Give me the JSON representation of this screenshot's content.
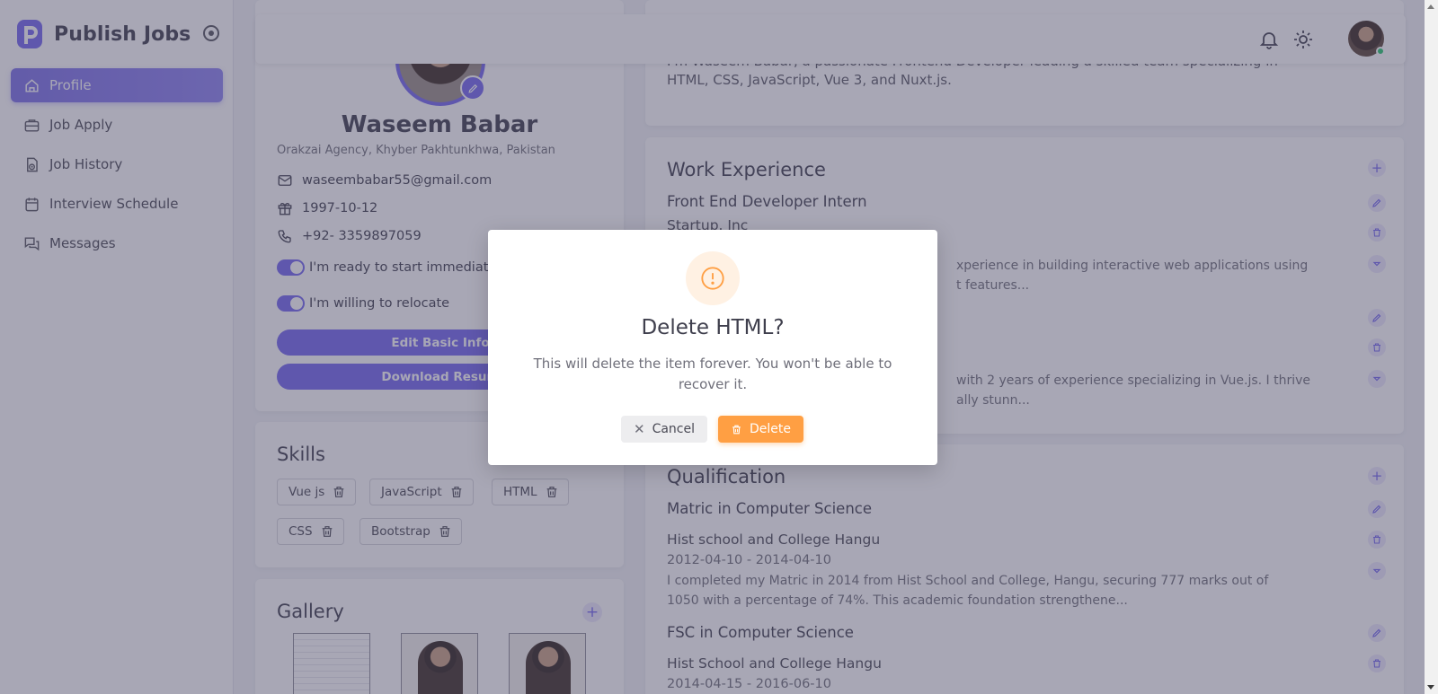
{
  "app": {
    "title": "Publish Jobs"
  },
  "sidebar": {
    "items": [
      {
        "label": "Profile",
        "icon": "home-icon",
        "active": true
      },
      {
        "label": "Job Apply",
        "icon": "briefcase-icon",
        "active": false
      },
      {
        "label": "Job History",
        "icon": "file-history-icon",
        "active": false
      },
      {
        "label": "Interview Schedule",
        "icon": "calendar-icon",
        "active": false
      },
      {
        "label": "Messages",
        "icon": "messages-icon",
        "active": false
      }
    ]
  },
  "topbar": {
    "icons": [
      "bell-icon",
      "sun-icon"
    ],
    "user_status": "online"
  },
  "profile": {
    "name": "Waseem Babar",
    "location": "Orakzai Agency, Khyber Pakhtunkhwa, Pakistan",
    "email": "waseembabar55@gmail.com",
    "birthdate": "1997-10-12",
    "phone": "+92- 3359897059",
    "toggle_ready": "I'm ready to start immediate",
    "toggle_relocate": "I'm willing to relocate",
    "edit_button": "Edit Basic Info",
    "download_button": "Download Resum"
  },
  "skills": {
    "title": "Skills",
    "items": [
      "Vue js",
      "JavaScript",
      "HTML",
      "CSS",
      "Bootstrap"
    ]
  },
  "gallery": {
    "title": "Gallery"
  },
  "about": {
    "line1": "I'm Waseem Babar, a passionate Frontend Developer leading a skilled team specializing in",
    "line2": "HTML, CSS, JavaScript, Vue 3, and Nuxt.js."
  },
  "work": {
    "title": "Work Experience",
    "items": [
      {
        "title": "Front End Developer Intern",
        "company": "Startup. Inc",
        "desc1": "xperience in building interactive web applications using",
        "desc2": "t features..."
      },
      {
        "desc1": "with 2 years of experience specializing in Vue.js. I thrive",
        "desc2": "ally stunn..."
      }
    ]
  },
  "qualification": {
    "title": "Qualification",
    "items": [
      {
        "title": "Matric in Computer Science",
        "school": "Hist school and College Hangu",
        "dates": "2012-04-10 -  2014-04-10",
        "desc1": "I completed my Matric in 2014 from Hist School and College, Hangu, securing 777 marks out of",
        "desc2": "1050 with a percentage of 74%. This academic foundation strengthene..."
      },
      {
        "title": "FSC in Computer Science",
        "school": "Hist School and College Hangu",
        "dates": "2014-04-15 -  2016-06-10"
      }
    ]
  },
  "modal": {
    "title": "Delete HTML?",
    "text": "This will delete the item forever. You won't be able to recover it.",
    "cancel": "Cancel",
    "delete": "Delete",
    "icon": "alert-circle-icon"
  },
  "colors": {
    "primary": "#7367f0",
    "warning": "#ff9f43",
    "success": "#28c76f"
  }
}
